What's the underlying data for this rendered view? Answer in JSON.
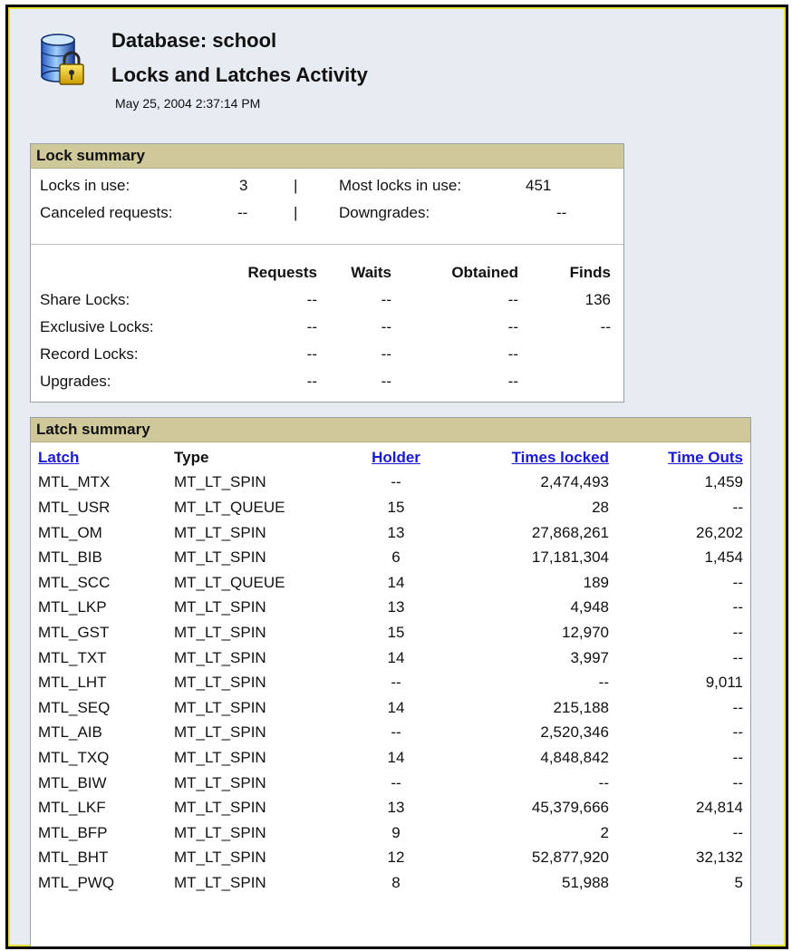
{
  "header": {
    "database_title": "Database: school",
    "page_title": "Locks and Latches Activity",
    "timestamp": "May 25, 2004 2:37:14 PM",
    "icon": "database-lock-icon"
  },
  "lock_summary": {
    "title": "Lock summary",
    "locks_in_use_label": "Locks in use:",
    "locks_in_use_value": "3",
    "most_locks_label": "Most locks in use:",
    "most_locks_value": "451",
    "canceled_label": "Canceled requests:",
    "canceled_value": "--",
    "downgrades_label": "Downgrades:",
    "downgrades_value": "--",
    "divider": "|",
    "columns": [
      "Requests",
      "Waits",
      "Obtained",
      "Finds"
    ],
    "rows": [
      {
        "label": "Share Locks:",
        "values": [
          "--",
          "--",
          "--",
          "136"
        ]
      },
      {
        "label": "Exclusive Locks:",
        "values": [
          "--",
          "--",
          "--",
          "--"
        ]
      },
      {
        "label": "Record Locks:",
        "values": [
          "--",
          "--",
          "--",
          ""
        ]
      },
      {
        "label": "Upgrades:",
        "values": [
          "--",
          "--",
          "--",
          ""
        ]
      }
    ]
  },
  "latch_summary": {
    "title": "Latch summary",
    "columns": {
      "latch": "Latch",
      "type": "Type",
      "holder": "Holder",
      "times_locked": "Times locked",
      "time_outs": "Time Outs"
    },
    "rows": [
      [
        "MTL_MTX",
        "MT_LT_SPIN",
        "--",
        "2,474,493",
        "1,459"
      ],
      [
        "MTL_USR",
        "MT_LT_QUEUE",
        "15",
        "28",
        "--"
      ],
      [
        "MTL_OM",
        "MT_LT_SPIN",
        "13",
        "27,868,261",
        "26,202"
      ],
      [
        "MTL_BIB",
        "MT_LT_SPIN",
        "6",
        "17,181,304",
        "1,454"
      ],
      [
        "MTL_SCC",
        "MT_LT_QUEUE",
        "14",
        "189",
        "--"
      ],
      [
        "MTL_LKP",
        "MT_LT_SPIN",
        "13",
        "4,948",
        "--"
      ],
      [
        "MTL_GST",
        "MT_LT_SPIN",
        "15",
        "12,970",
        "--"
      ],
      [
        "MTL_TXT",
        "MT_LT_SPIN",
        "14",
        "3,997",
        "--"
      ],
      [
        "MTL_LHT",
        "MT_LT_SPIN",
        "--",
        "--",
        "9,011"
      ],
      [
        "MTL_SEQ",
        "MT_LT_SPIN",
        "14",
        "215,188",
        "--"
      ],
      [
        "MTL_AIB",
        "MT_LT_SPIN",
        "--",
        "2,520,346",
        "--"
      ],
      [
        "MTL_TXQ",
        "MT_LT_SPIN",
        "14",
        "4,848,842",
        "--"
      ],
      [
        "MTL_BIW",
        "MT_LT_SPIN",
        "--",
        "--",
        "--"
      ],
      [
        "MTL_LKF",
        "MT_LT_SPIN",
        "13",
        "45,379,666",
        "24,814"
      ],
      [
        "MTL_BFP",
        "MT_LT_SPIN",
        "9",
        "2",
        "--"
      ],
      [
        "MTL_BHT",
        "MT_LT_SPIN",
        "12",
        "52,877,920",
        "32,132"
      ],
      [
        "MTL_PWQ",
        "MT_LT_SPIN",
        "8",
        "51,988",
        "5"
      ]
    ]
  }
}
